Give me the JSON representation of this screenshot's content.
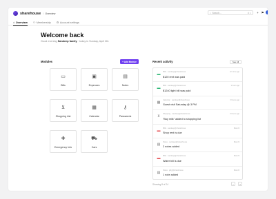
{
  "header": {
    "brand": "sharehouse",
    "separator": "/",
    "crumb": "Overview",
    "search_placeholder": "Search...",
    "search_shortcut": "⌘ K",
    "icons": [
      "plus-icon",
      "bell-icon",
      "avatar"
    ]
  },
  "tabs": [
    {
      "label": "Overview",
      "icon": "home-icon",
      "active": true
    },
    {
      "label": "Membership",
      "icon": "users-icon",
      "active": false
    },
    {
      "label": "Account settings",
      "icon": "settings-icon",
      "active": false
    }
  ],
  "welcome": {
    "title": "Welcome back",
    "greeting_prefix": "Good evening",
    "family": "Sandeep family",
    "greeting_suffix": "· today is Sunday, April 6th"
  },
  "modules": {
    "title": "Modules",
    "add_label": "+ Add Module",
    "items": [
      {
        "label": "Bills",
        "icon": "money-icon"
      },
      {
        "label": "Expenses",
        "icon": "wallet-icon"
      },
      {
        "label": "Notes",
        "icon": "note-icon"
      },
      {
        "label": "Shopping List",
        "icon": "cart-icon"
      },
      {
        "label": "Calendar",
        "icon": "calendar-icon"
      },
      {
        "label": "Passwords",
        "icon": "key-icon"
      },
      {
        "label": "Emergency Info",
        "icon": "first-aid-icon"
      },
      {
        "label": "Cars",
        "icon": "car-icon"
      }
    ]
  },
  "activity": {
    "title": "Recent activity",
    "see_all": "See All",
    "items": [
      {
        "meta": "Bills · sandeep@sharehouse",
        "text": "$120 rent was paid",
        "time": "12 mins ago",
        "icon": "money-icon",
        "color": "#2bb673"
      },
      {
        "meta": "Bills · sandeep@sharehouse",
        "text": "$1240 light bill was paid",
        "time": "1 hour ago",
        "icon": "money-icon",
        "color": "#2bb673"
      },
      {
        "meta": "Calendar · sandeep@sharehouse",
        "text": "Guest visit Saturday @ 3 PM",
        "time": "3 hours ago",
        "icon": "calendar-icon",
        "color": "#777777"
      },
      {
        "meta": "Shopping · sandeep@sharehouse",
        "text": "\"Buy milk\" added to shopping list",
        "time": "6 hours ago",
        "icon": "cart-icon",
        "color": "#777777"
      },
      {
        "meta": "Bills · sandeep@sharehouse",
        "text": "Shop rent is due",
        "time": "Mar 24",
        "icon": "money-icon",
        "color": "#e5484d"
      },
      {
        "meta": "Notes · sandeep@sharehouse",
        "text": "2 notes added",
        "time": "Mar 24",
        "icon": "note-icon",
        "color": "#777777"
      },
      {
        "meta": "Bills · sandeep@sharehouse",
        "text": "Water bill is due",
        "time": "Mar 23",
        "icon": "money-icon",
        "color": "#e5484d"
      },
      {
        "meta": "Notes · jelly@sharehouse",
        "text": "1 note added",
        "time": "Mar 22",
        "icon": "note-icon",
        "color": "#777777"
      }
    ],
    "showing": "Showing 8 of 24",
    "prev": "‹",
    "next": "›"
  }
}
